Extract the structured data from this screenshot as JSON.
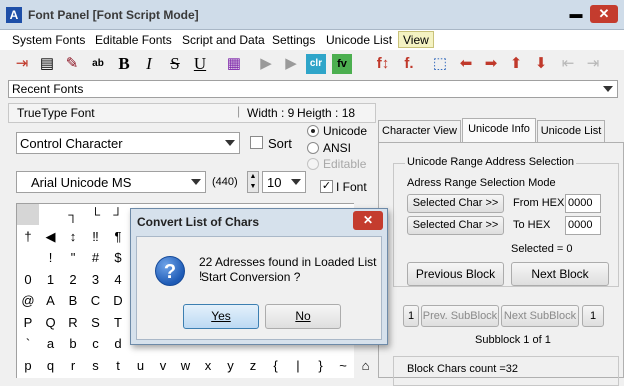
{
  "window": {
    "title": "Font Panel [Font Script Mode]"
  },
  "menu": [
    "System Fonts",
    "Editable Fonts",
    "Script and Data",
    "Settings",
    "Unicode List",
    "View"
  ],
  "recent_fonts": "Recent Fonts",
  "info": {
    "font_type": "TrueType Font",
    "width": "Width : 9",
    "height": "Heigth : 18"
  },
  "char_set": "Control Character",
  "sort_label": "Sort",
  "encoding": {
    "unicode": "Unicode",
    "ansi": "ANSI",
    "editable": "Editable"
  },
  "font_name": "Arial Unicode MS",
  "font_count": "(440)",
  "font_size": "10",
  "ifont_label": "I Font",
  "grid_rows": [
    [
      "",
      "",
      "┐",
      "└",
      "┘",
      "",
      "",
      ""
    ],
    [
      "†",
      "◀",
      "↕",
      "‼",
      "¶",
      "",
      "",
      ""
    ],
    [
      "",
      "!",
      "\"",
      "#",
      "$",
      "",
      "",
      ""
    ],
    [
      "0",
      "1",
      "2",
      "3",
      "4",
      "",
      "",
      ""
    ],
    [
      "@",
      "A",
      "B",
      "C",
      "D",
      "",
      "",
      ""
    ],
    [
      "P",
      "Q",
      "R",
      "S",
      "T",
      "",
      "",
      ""
    ],
    [
      "`",
      "a",
      "b",
      "c",
      "d",
      "",
      "",
      ""
    ],
    [
      "p",
      "q",
      "r",
      "s",
      "t",
      "u",
      "v",
      "w",
      "x",
      "y",
      "z",
      "{",
      "|",
      "}",
      "~",
      "⌂"
    ]
  ],
  "tabs": [
    "Character View",
    "Unicode Info",
    "Unicode List"
  ],
  "unicode_info": {
    "group_title": "Unicode Range Address Selection",
    "mode_label": "Adress Range Selection Mode",
    "selected_btn": "Selected Char >>",
    "from_label": "From HEX",
    "to_label": "To HEX",
    "from_value": "0000",
    "to_value": "0000",
    "selected_count": "Selected = 0",
    "prev_block": "Previous Block",
    "next_block": "Next Block",
    "left_num": "1",
    "prev_sub": "Prev. SubBlock",
    "next_sub": "Next SubBlock",
    "right_num": "1",
    "subblock": "Subblock 1 of 1",
    "block_chars": "Block Chars count =32"
  },
  "dialog": {
    "title": "Convert List of Chars",
    "line1": "22 Adresses found in Loaded List !",
    "line2": "Start Conversion ?",
    "yes": "Yes",
    "no": "No"
  },
  "colors": {
    "accent_red": "#c43c2e",
    "titlebar": "#cfdce9",
    "yes_button": "#bcd9f3"
  }
}
